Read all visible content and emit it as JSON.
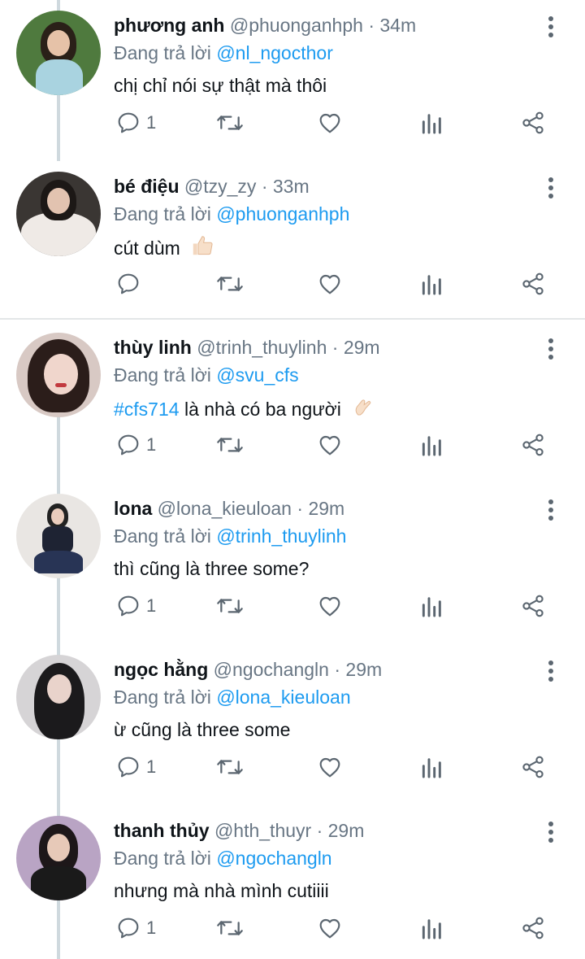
{
  "reply_prefix": "Đang trả lời",
  "tweets": [
    {
      "name": "phương anh",
      "handle": "@phuonganhph",
      "dot": "·",
      "time": "34m",
      "reply_to": "@nl_ngocthor",
      "hashtag": "",
      "text": "chị chỉ nói sự thật mà thôi",
      "emoji": "",
      "reply_count": "1"
    },
    {
      "name": "bé điệu",
      "handle": "@tzy_zy",
      "dot": "·",
      "time": "33m",
      "reply_to": "@phuonganhph",
      "hashtag": "",
      "text": "cút dùm",
      "emoji": "thumbs-up-emoji",
      "reply_count": ""
    },
    {
      "name": "thùy linh",
      "handle": "@trinh_thuylinh",
      "dot": "·",
      "time": "29m",
      "reply_to": "@svu_cfs",
      "hashtag": "#cfs714",
      "text": "là nhà có ba người",
      "emoji": "pinching-hand-emoji",
      "reply_count": "1"
    },
    {
      "name": "lona",
      "handle": "@lona_kieuloan",
      "dot": "·",
      "time": "29m",
      "reply_to": "@trinh_thuylinh",
      "hashtag": "",
      "text": "thì cũng là three some?",
      "emoji": "",
      "reply_count": "1"
    },
    {
      "name": "ngọc hằng",
      "handle": "@ngochangln",
      "dot": "·",
      "time": "29m",
      "reply_to": "@lona_kieuloan",
      "hashtag": "",
      "text": "ừ cũng là three some",
      "emoji": "",
      "reply_count": "1"
    },
    {
      "name": "thanh thủy",
      "handle": "@hth_thuyr",
      "dot": "·",
      "time": "29m",
      "reply_to": "@ngochangln",
      "hashtag": "",
      "text": "nhưng mà nhà mình cutiiii",
      "emoji": "",
      "reply_count": "1"
    }
  ],
  "colors": {
    "mention": "#1d9bf0",
    "secondary_text": "#687684",
    "icon": "#5b6670",
    "thread_line": "#cfd9de"
  }
}
